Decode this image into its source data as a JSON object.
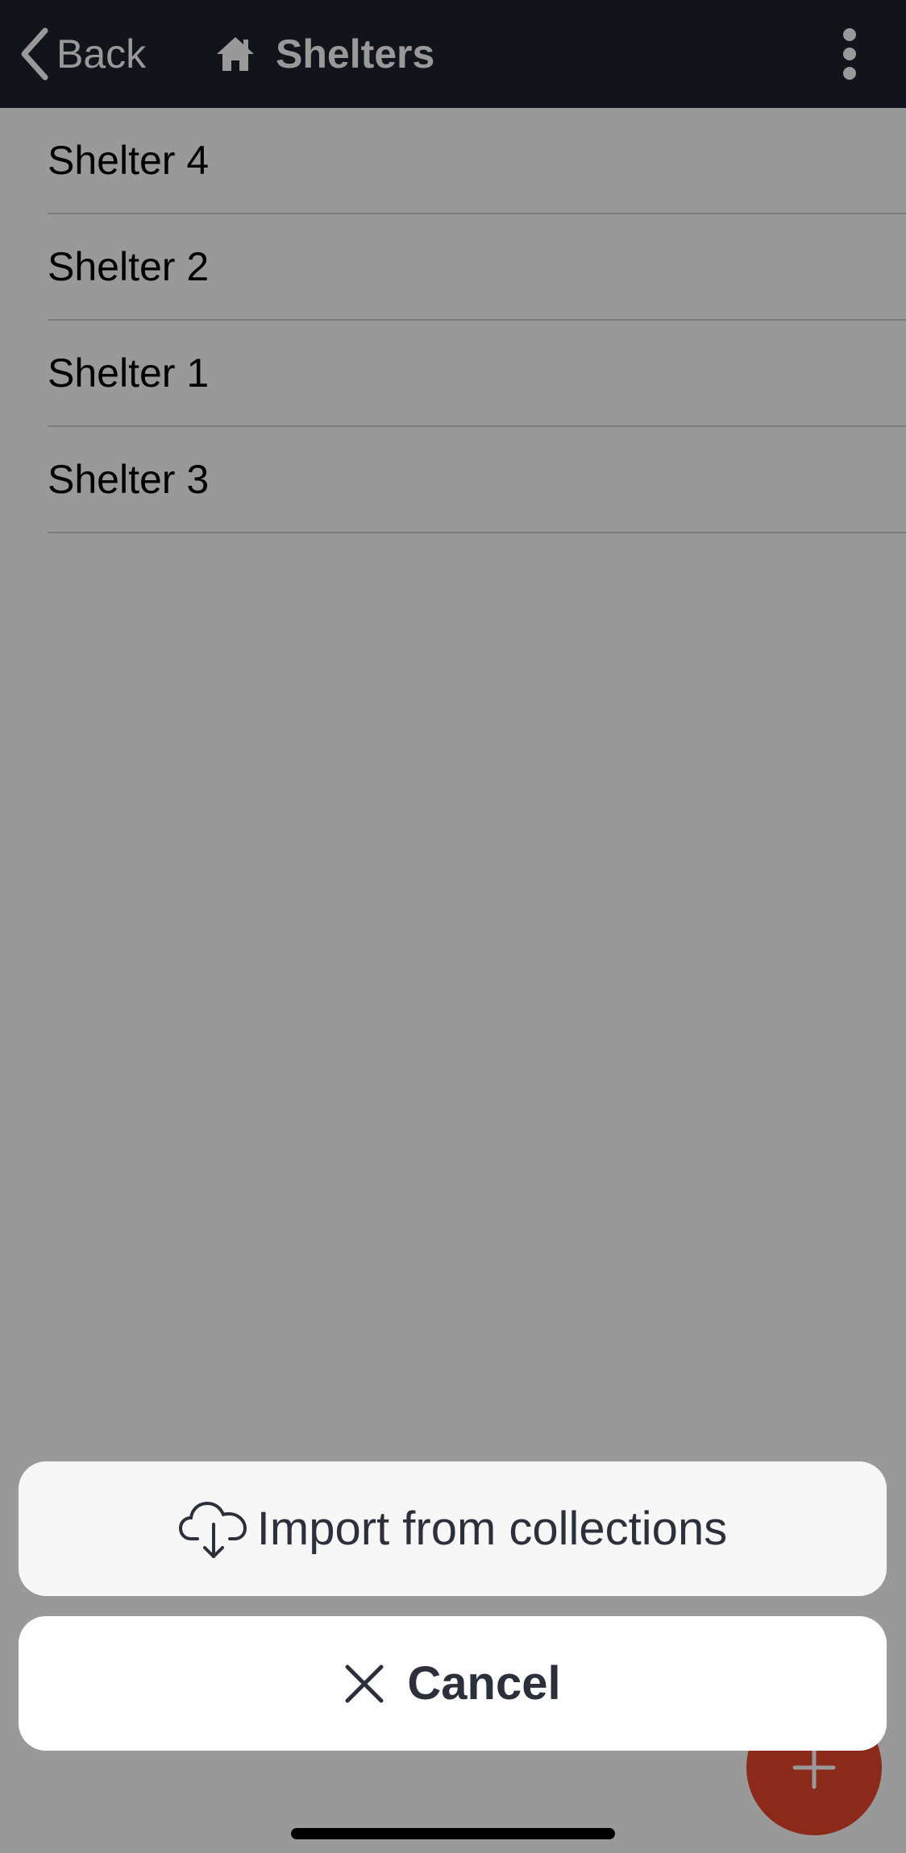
{
  "header": {
    "back_label": "Back",
    "title": "Shelters",
    "background": "#1e222d",
    "icons": {
      "back": "chevron-left-icon",
      "title": "home-icon",
      "menu": "more-vertical-icon"
    }
  },
  "list": {
    "items": [
      {
        "label": "Shelter 4"
      },
      {
        "label": "Shelter 2"
      },
      {
        "label": "Shelter 1"
      },
      {
        "label": "Shelter 3"
      }
    ]
  },
  "fab": {
    "icon": "plus-icon",
    "color": "#e8452c"
  },
  "action_sheet": {
    "import": {
      "label": "Import from collections",
      "icon": "cloud-download-icon"
    },
    "cancel": {
      "label": "Cancel",
      "icon": "close-icon"
    },
    "text_color": "#2b303b"
  }
}
